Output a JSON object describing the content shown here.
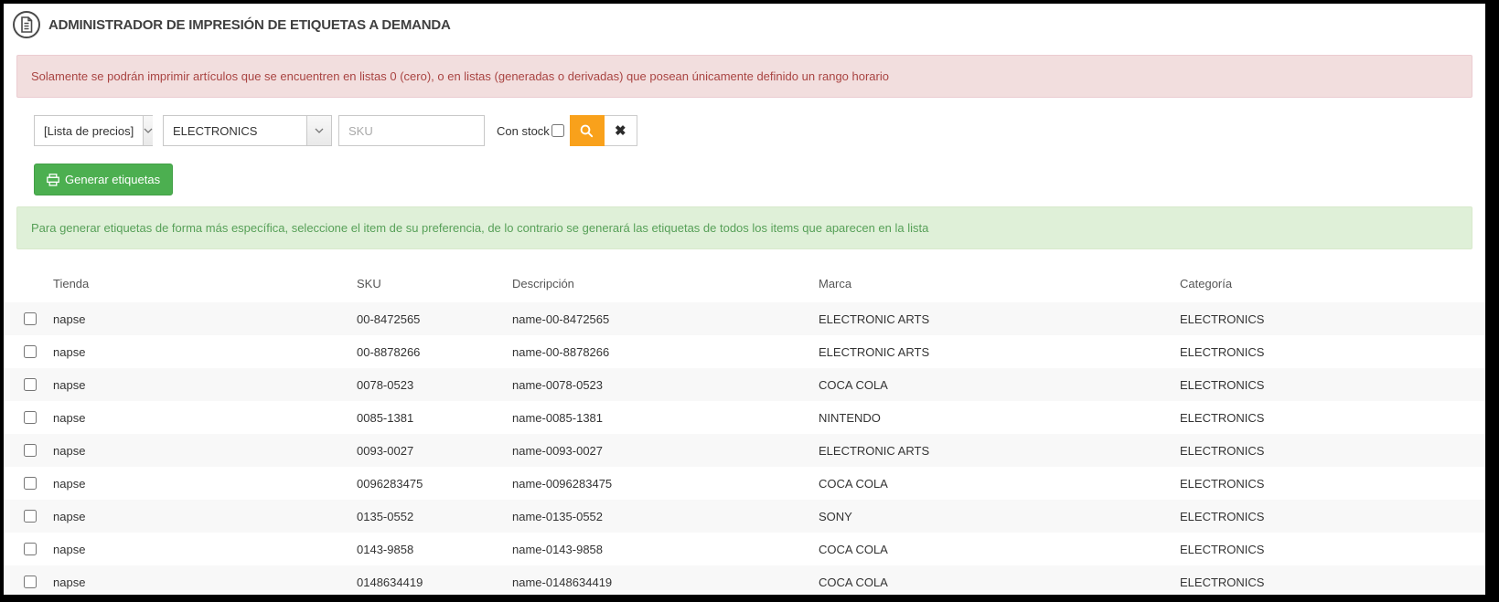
{
  "header": {
    "title": "ADMINISTRADOR DE IMPRESIÓN DE ETIQUETAS A DEMANDA"
  },
  "alerts": {
    "restriction": "Solamente se podrán imprimir artículos que se encuentren en listas 0 (cero), o en listas (generadas o derivadas) que posean únicamente definido un rango horario",
    "hint": "Para generar etiquetas de forma más específica, seleccione el item de su preferencia, de lo contrario se generará las etiquetas de todos los items que aparecen en la lista"
  },
  "filters": {
    "price_list": {
      "selected": "[Lista de precios]"
    },
    "category": {
      "selected": "ELECTRONICS"
    },
    "sku": {
      "placeholder": "SKU",
      "value": ""
    },
    "con_stock": {
      "label": "Con stock",
      "checked": false
    }
  },
  "buttons": {
    "generate": "Generar etiquetas",
    "clear_glyph": "✖"
  },
  "icons": {
    "title": "document-icon",
    "search": "magnifier-icon",
    "clear": "x-icon",
    "generate": "printer-icon",
    "select_chevron": "chevron-down-icon"
  },
  "colors": {
    "accent_orange": "#f9a11b",
    "accent_green": "#4caf50",
    "danger_bg": "#f2dede",
    "danger_text": "#a94442",
    "success_bg": "#dff0d8",
    "success_text": "#57a058"
  },
  "table": {
    "columns": [
      "Tienda",
      "SKU",
      "Descripción",
      "Marca",
      "Categoría"
    ],
    "rows": [
      {
        "tienda": "napse",
        "sku": "00-8472565",
        "descripcion": "name-00-8472565",
        "marca": "ELECTRONIC ARTS",
        "categoria": "ELECTRONICS"
      },
      {
        "tienda": "napse",
        "sku": "00-8878266",
        "descripcion": "name-00-8878266",
        "marca": "ELECTRONIC ARTS",
        "categoria": "ELECTRONICS"
      },
      {
        "tienda": "napse",
        "sku": "0078-0523",
        "descripcion": "name-0078-0523",
        "marca": "COCA COLA",
        "categoria": "ELECTRONICS"
      },
      {
        "tienda": "napse",
        "sku": "0085-1381",
        "descripcion": "name-0085-1381",
        "marca": "NINTENDO",
        "categoria": "ELECTRONICS"
      },
      {
        "tienda": "napse",
        "sku": "0093-0027",
        "descripcion": "name-0093-0027",
        "marca": "ELECTRONIC ARTS",
        "categoria": "ELECTRONICS"
      },
      {
        "tienda": "napse",
        "sku": "0096283475",
        "descripcion": "name-0096283475",
        "marca": "COCA COLA",
        "categoria": "ELECTRONICS"
      },
      {
        "tienda": "napse",
        "sku": "0135-0552",
        "descripcion": "name-0135-0552",
        "marca": "SONY",
        "categoria": "ELECTRONICS"
      },
      {
        "tienda": "napse",
        "sku": "0143-9858",
        "descripcion": "name-0143-9858",
        "marca": "COCA COLA",
        "categoria": "ELECTRONICS"
      },
      {
        "tienda": "napse",
        "sku": "0148634419",
        "descripcion": "name-0148634419",
        "marca": "COCA COLA",
        "categoria": "ELECTRONICS"
      }
    ]
  }
}
